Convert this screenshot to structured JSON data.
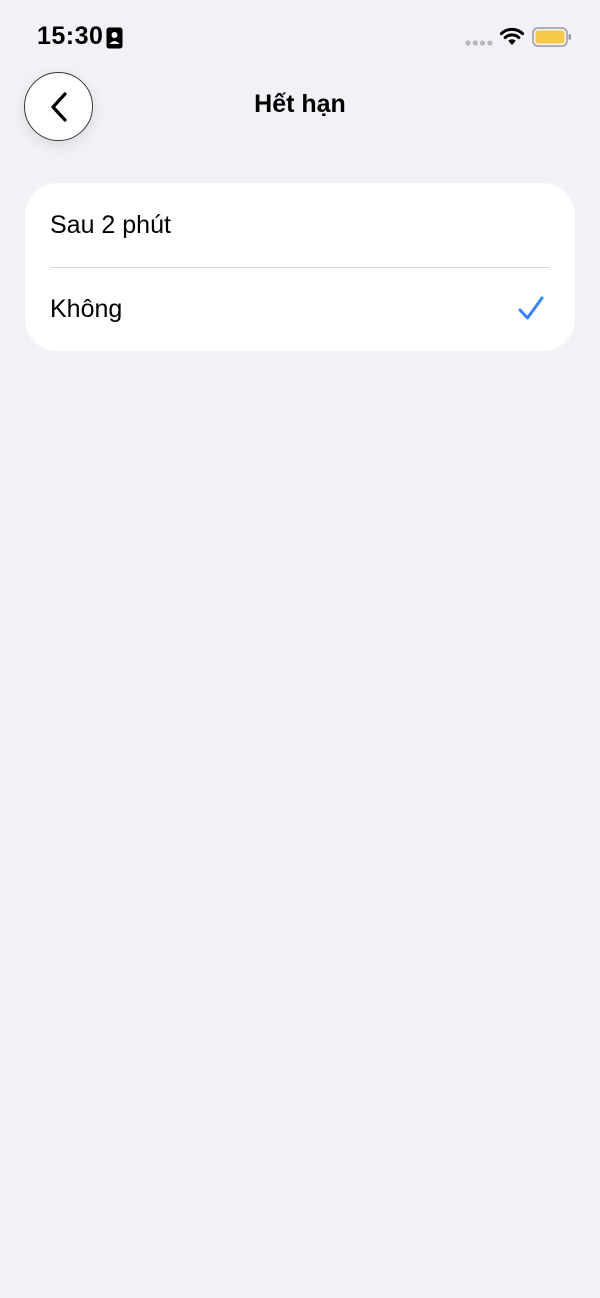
{
  "status_bar": {
    "time": "15:30",
    "icons": [
      "id-card-icon",
      "signal-icon",
      "wifi-icon",
      "battery-icon"
    ],
    "battery_color": "#f7c948"
  },
  "header": {
    "back_icon": "chevron-left-icon",
    "title": "Hết hạn"
  },
  "options": [
    {
      "label": "Sau 2 phút",
      "selected": false
    },
    {
      "label": "Không",
      "selected": true
    }
  ],
  "colors": {
    "background": "#f2f1f6",
    "card": "#ffffff",
    "accent": "#3b82f6"
  }
}
